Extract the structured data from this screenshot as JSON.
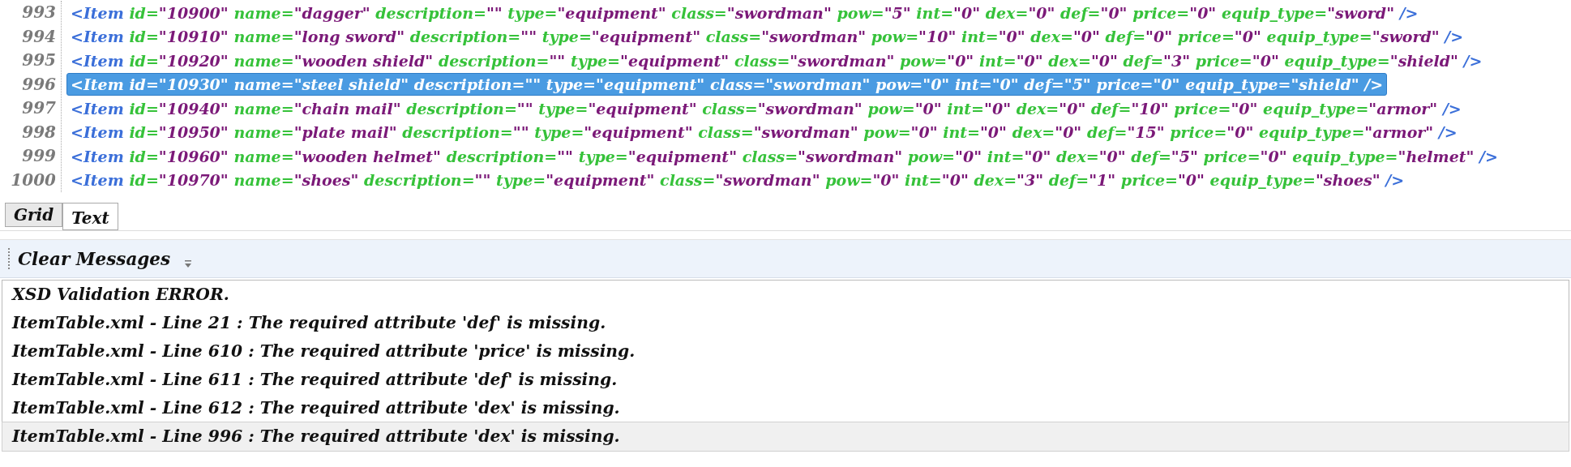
{
  "editor": {
    "lines": [
      {
        "number": "993",
        "selected": false,
        "tokens": [
          {
            "kind": "tag",
            "text": "<Item"
          },
          {
            "kind": "attr",
            "text": "id="
          },
          {
            "kind": "value",
            "text": "\"10900\""
          },
          {
            "kind": "attr",
            "text": "name="
          },
          {
            "kind": "value",
            "text": "\"dagger\""
          },
          {
            "kind": "attr",
            "text": "description="
          },
          {
            "kind": "value",
            "text": "\"\""
          },
          {
            "kind": "attr",
            "text": "type="
          },
          {
            "kind": "value",
            "text": "\"equipment\""
          },
          {
            "kind": "attr",
            "text": "class="
          },
          {
            "kind": "value",
            "text": "\"swordman\""
          },
          {
            "kind": "attr",
            "text": "pow="
          },
          {
            "kind": "value",
            "text": "\"5\""
          },
          {
            "kind": "attr",
            "text": "int="
          },
          {
            "kind": "value",
            "text": "\"0\""
          },
          {
            "kind": "attr",
            "text": "dex="
          },
          {
            "kind": "value",
            "text": "\"0\""
          },
          {
            "kind": "attr",
            "text": "def="
          },
          {
            "kind": "value",
            "text": "\"0\""
          },
          {
            "kind": "attr",
            "text": "price="
          },
          {
            "kind": "value",
            "text": "\"0\""
          },
          {
            "kind": "attr",
            "text": "equip_type="
          },
          {
            "kind": "value",
            "text": "\"sword\""
          },
          {
            "kind": "tag",
            "text": "/>"
          }
        ]
      },
      {
        "number": "994",
        "selected": false,
        "tokens": [
          {
            "kind": "tag",
            "text": "<Item"
          },
          {
            "kind": "attr",
            "text": "id="
          },
          {
            "kind": "value",
            "text": "\"10910\""
          },
          {
            "kind": "attr",
            "text": "name="
          },
          {
            "kind": "value",
            "text": "\"long sword\""
          },
          {
            "kind": "attr",
            "text": "description="
          },
          {
            "kind": "value",
            "text": "\"\""
          },
          {
            "kind": "attr",
            "text": "type="
          },
          {
            "kind": "value",
            "text": "\"equipment\""
          },
          {
            "kind": "attr",
            "text": "class="
          },
          {
            "kind": "value",
            "text": "\"swordman\""
          },
          {
            "kind": "attr",
            "text": "pow="
          },
          {
            "kind": "value",
            "text": "\"10\""
          },
          {
            "kind": "attr",
            "text": "int="
          },
          {
            "kind": "value",
            "text": "\"0\""
          },
          {
            "kind": "attr",
            "text": "dex="
          },
          {
            "kind": "value",
            "text": "\"0\""
          },
          {
            "kind": "attr",
            "text": "def="
          },
          {
            "kind": "value",
            "text": "\"0\""
          },
          {
            "kind": "attr",
            "text": "price="
          },
          {
            "kind": "value",
            "text": "\"0\""
          },
          {
            "kind": "attr",
            "text": "equip_type="
          },
          {
            "kind": "value",
            "text": "\"sword\""
          },
          {
            "kind": "tag",
            "text": "/>"
          }
        ]
      },
      {
        "number": "995",
        "selected": false,
        "tokens": [
          {
            "kind": "tag",
            "text": "<Item"
          },
          {
            "kind": "attr",
            "text": "id="
          },
          {
            "kind": "value",
            "text": "\"10920\""
          },
          {
            "kind": "attr",
            "text": "name="
          },
          {
            "kind": "value",
            "text": "\"wooden shield\""
          },
          {
            "kind": "attr",
            "text": "description="
          },
          {
            "kind": "value",
            "text": "\"\""
          },
          {
            "kind": "attr",
            "text": "type="
          },
          {
            "kind": "value",
            "text": "\"equipment\""
          },
          {
            "kind": "attr",
            "text": "class="
          },
          {
            "kind": "value",
            "text": "\"swordman\""
          },
          {
            "kind": "attr",
            "text": "pow="
          },
          {
            "kind": "value",
            "text": "\"0\""
          },
          {
            "kind": "attr",
            "text": "int="
          },
          {
            "kind": "value",
            "text": "\"0\""
          },
          {
            "kind": "attr",
            "text": "dex="
          },
          {
            "kind": "value",
            "text": "\"0\""
          },
          {
            "kind": "attr",
            "text": "def="
          },
          {
            "kind": "value",
            "text": "\"3\""
          },
          {
            "kind": "attr",
            "text": "price="
          },
          {
            "kind": "value",
            "text": "\"0\""
          },
          {
            "kind": "attr",
            "text": "equip_type="
          },
          {
            "kind": "value",
            "text": "\"shield\""
          },
          {
            "kind": "tag",
            "text": "/>"
          }
        ]
      },
      {
        "number": "996",
        "selected": true,
        "tokens": [
          {
            "kind": "tag",
            "text": "<Item"
          },
          {
            "kind": "attr",
            "text": "id="
          },
          {
            "kind": "value",
            "text": "\"10930\""
          },
          {
            "kind": "attr",
            "text": "name="
          },
          {
            "kind": "value",
            "text": "\"steel shield\""
          },
          {
            "kind": "attr",
            "text": "description="
          },
          {
            "kind": "value",
            "text": "\"\""
          },
          {
            "kind": "attr",
            "text": "type="
          },
          {
            "kind": "value",
            "text": "\"equipment\""
          },
          {
            "kind": "attr",
            "text": "class="
          },
          {
            "kind": "value",
            "text": "\"swordman\""
          },
          {
            "kind": "attr",
            "text": "pow="
          },
          {
            "kind": "value",
            "text": "\"0\""
          },
          {
            "kind": "attr",
            "text": "int="
          },
          {
            "kind": "value",
            "text": "\"0\""
          },
          {
            "kind": "attr",
            "text": "def="
          },
          {
            "kind": "value",
            "text": "\"5\""
          },
          {
            "kind": "attr",
            "text": "price="
          },
          {
            "kind": "value",
            "text": "\"0\""
          },
          {
            "kind": "attr",
            "text": "equip_type="
          },
          {
            "kind": "value",
            "text": "\"shield\""
          },
          {
            "kind": "tag",
            "text": "/>"
          }
        ]
      },
      {
        "number": "997",
        "selected": false,
        "tokens": [
          {
            "kind": "tag",
            "text": "<Item"
          },
          {
            "kind": "attr",
            "text": "id="
          },
          {
            "kind": "value",
            "text": "\"10940\""
          },
          {
            "kind": "attr",
            "text": "name="
          },
          {
            "kind": "value",
            "text": "\"chain mail\""
          },
          {
            "kind": "attr",
            "text": "description="
          },
          {
            "kind": "value",
            "text": "\"\""
          },
          {
            "kind": "attr",
            "text": "type="
          },
          {
            "kind": "value",
            "text": "\"equipment\""
          },
          {
            "kind": "attr",
            "text": "class="
          },
          {
            "kind": "value",
            "text": "\"swordman\""
          },
          {
            "kind": "attr",
            "text": "pow="
          },
          {
            "kind": "value",
            "text": "\"0\""
          },
          {
            "kind": "attr",
            "text": "int="
          },
          {
            "kind": "value",
            "text": "\"0\""
          },
          {
            "kind": "attr",
            "text": "dex="
          },
          {
            "kind": "value",
            "text": "\"0\""
          },
          {
            "kind": "attr",
            "text": "def="
          },
          {
            "kind": "value",
            "text": "\"10\""
          },
          {
            "kind": "attr",
            "text": "price="
          },
          {
            "kind": "value",
            "text": "\"0\""
          },
          {
            "kind": "attr",
            "text": "equip_type="
          },
          {
            "kind": "value",
            "text": "\"armor\""
          },
          {
            "kind": "tag",
            "text": "/>"
          }
        ]
      },
      {
        "number": "998",
        "selected": false,
        "tokens": [
          {
            "kind": "tag",
            "text": "<Item"
          },
          {
            "kind": "attr",
            "text": "id="
          },
          {
            "kind": "value",
            "text": "\"10950\""
          },
          {
            "kind": "attr",
            "text": "name="
          },
          {
            "kind": "value",
            "text": "\"plate mail\""
          },
          {
            "kind": "attr",
            "text": "description="
          },
          {
            "kind": "value",
            "text": "\"\""
          },
          {
            "kind": "attr",
            "text": "type="
          },
          {
            "kind": "value",
            "text": "\"equipment\""
          },
          {
            "kind": "attr",
            "text": "class="
          },
          {
            "kind": "value",
            "text": "\"swordman\""
          },
          {
            "kind": "attr",
            "text": "pow="
          },
          {
            "kind": "value",
            "text": "\"0\""
          },
          {
            "kind": "attr",
            "text": "int="
          },
          {
            "kind": "value",
            "text": "\"0\""
          },
          {
            "kind": "attr",
            "text": "dex="
          },
          {
            "kind": "value",
            "text": "\"0\""
          },
          {
            "kind": "attr",
            "text": "def="
          },
          {
            "kind": "value",
            "text": "\"15\""
          },
          {
            "kind": "attr",
            "text": "price="
          },
          {
            "kind": "value",
            "text": "\"0\""
          },
          {
            "kind": "attr",
            "text": "equip_type="
          },
          {
            "kind": "value",
            "text": "\"armor\""
          },
          {
            "kind": "tag",
            "text": "/>"
          }
        ]
      },
      {
        "number": "999",
        "selected": false,
        "tokens": [
          {
            "kind": "tag",
            "text": "<Item"
          },
          {
            "kind": "attr",
            "text": "id="
          },
          {
            "kind": "value",
            "text": "\"10960\""
          },
          {
            "kind": "attr",
            "text": "name="
          },
          {
            "kind": "value",
            "text": "\"wooden helmet\""
          },
          {
            "kind": "attr",
            "text": "description="
          },
          {
            "kind": "value",
            "text": "\"\""
          },
          {
            "kind": "attr",
            "text": "type="
          },
          {
            "kind": "value",
            "text": "\"equipment\""
          },
          {
            "kind": "attr",
            "text": "class="
          },
          {
            "kind": "value",
            "text": "\"swordman\""
          },
          {
            "kind": "attr",
            "text": "pow="
          },
          {
            "kind": "value",
            "text": "\"0\""
          },
          {
            "kind": "attr",
            "text": "int="
          },
          {
            "kind": "value",
            "text": "\"0\""
          },
          {
            "kind": "attr",
            "text": "dex="
          },
          {
            "kind": "value",
            "text": "\"0\""
          },
          {
            "kind": "attr",
            "text": "def="
          },
          {
            "kind": "value",
            "text": "\"5\""
          },
          {
            "kind": "attr",
            "text": "price="
          },
          {
            "kind": "value",
            "text": "\"0\""
          },
          {
            "kind": "attr",
            "text": "equip_type="
          },
          {
            "kind": "value",
            "text": "\"helmet\""
          },
          {
            "kind": "tag",
            "text": "/>"
          }
        ]
      },
      {
        "number": "1000",
        "selected": false,
        "tokens": [
          {
            "kind": "tag",
            "text": "<Item"
          },
          {
            "kind": "attr",
            "text": "id="
          },
          {
            "kind": "value",
            "text": "\"10970\""
          },
          {
            "kind": "attr",
            "text": "name="
          },
          {
            "kind": "value",
            "text": "\"shoes\""
          },
          {
            "kind": "attr",
            "text": "description="
          },
          {
            "kind": "value",
            "text": "\"\""
          },
          {
            "kind": "attr",
            "text": "type="
          },
          {
            "kind": "value",
            "text": "\"equipment\""
          },
          {
            "kind": "attr",
            "text": "class="
          },
          {
            "kind": "value",
            "text": "\"swordman\""
          },
          {
            "kind": "attr",
            "text": "pow="
          },
          {
            "kind": "value",
            "text": "\"0\""
          },
          {
            "kind": "attr",
            "text": "int="
          },
          {
            "kind": "value",
            "text": "\"0\""
          },
          {
            "kind": "attr",
            "text": "dex="
          },
          {
            "kind": "value",
            "text": "\"3\""
          },
          {
            "kind": "attr",
            "text": "def="
          },
          {
            "kind": "value",
            "text": "\"1\""
          },
          {
            "kind": "attr",
            "text": "price="
          },
          {
            "kind": "value",
            "text": "\"0\""
          },
          {
            "kind": "attr",
            "text": "equip_type="
          },
          {
            "kind": "value",
            "text": "\"shoes\""
          },
          {
            "kind": "tag",
            "text": "/>"
          }
        ]
      }
    ]
  },
  "tabs": [
    {
      "label": "Grid",
      "selected": false
    },
    {
      "label": "Text",
      "selected": true
    }
  ],
  "messages": {
    "toolbar": {
      "button": "Clear Messages"
    },
    "items": [
      {
        "text": "XSD Validation ERROR.",
        "selected": false
      },
      {
        "text": "ItemTable.xml - Line 21 : The required attribute 'def' is missing.",
        "selected": false
      },
      {
        "text": "ItemTable.xml - Line 610 : The required attribute 'price' is missing.",
        "selected": false
      },
      {
        "text": "ItemTable.xml - Line 611 : The required attribute 'def' is missing.",
        "selected": false
      },
      {
        "text": "ItemTable.xml - Line 612 : The required attribute 'dex' is missing.",
        "selected": false
      },
      {
        "text": "ItemTable.xml - Line 996 : The required attribute 'dex' is missing.",
        "selected": true
      }
    ]
  }
}
